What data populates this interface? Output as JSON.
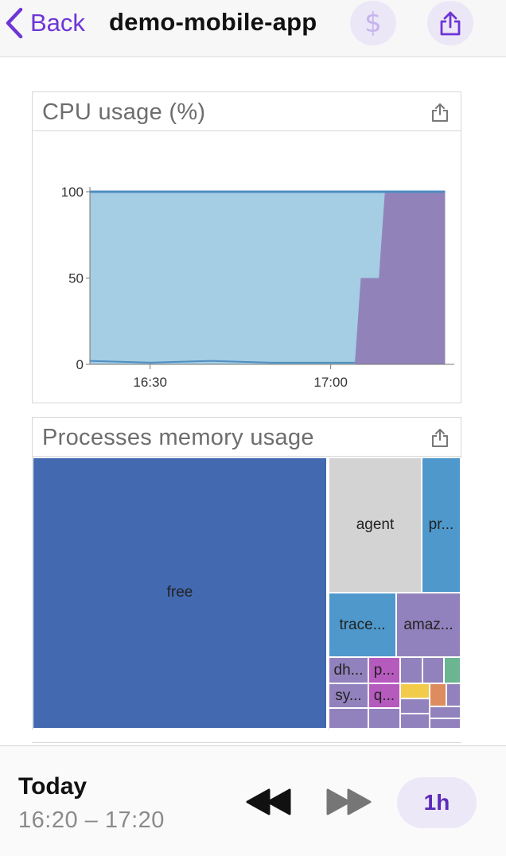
{
  "navbar": {
    "back_label": "Back",
    "title": "demo-mobile-app",
    "dollar_symbol": "$",
    "accent_color": "#6e35d6"
  },
  "cpu_widget": {
    "title": "CPU usage (%)"
  },
  "memory_widget": {
    "title": "Processes memory usage",
    "cells": [
      {
        "label": "free",
        "color": "#4369b0"
      },
      {
        "label": "agent",
        "color": "#d3d3d3"
      },
      {
        "label": "pr...",
        "color": "#4f98cb"
      },
      {
        "label": "trace...",
        "color": "#4f98cb"
      },
      {
        "label": "amaz...",
        "color": "#9182bd"
      },
      {
        "label": "dh...",
        "color": "#9182bd"
      },
      {
        "label": "p...",
        "color": "#b65bbe"
      },
      {
        "label": "sy...",
        "color": "#9182bd"
      },
      {
        "label": "q...",
        "color": "#b65bbe"
      },
      {
        "label": "",
        "color": "#9182bd"
      },
      {
        "label": "",
        "color": "#9182bd"
      },
      {
        "label": "",
        "color": "#6bb593"
      },
      {
        "label": "",
        "color": "#f3cb4a"
      },
      {
        "label": "",
        "color": "#dc8c5e"
      },
      {
        "label": "",
        "color": "#9182bd"
      },
      {
        "label": "",
        "color": "#9182bd"
      },
      {
        "label": "",
        "color": "#9182bd"
      },
      {
        "label": "",
        "color": "#9182bd"
      },
      {
        "label": "",
        "color": "#9182bd"
      },
      {
        "label": "",
        "color": "#9182bd"
      },
      {
        "label": "",
        "color": "#9182bd"
      }
    ]
  },
  "chart_data": {
    "type": "area",
    "title": "CPU usage (%)",
    "xlabel": "",
    "ylabel": "",
    "x_ticks": [
      "16:30",
      "17:00"
    ],
    "x_range": [
      "16:20",
      "17:20"
    ],
    "y_ticks": [
      0,
      50,
      100
    ],
    "ylim": [
      0,
      100
    ],
    "grid": false,
    "series": [
      {
        "color": "#a5cde3",
        "x": [
          "16:20",
          "16:30",
          "16:40",
          "16:50",
          "17:00",
          "17:04",
          "17:05",
          "17:08",
          "17:09",
          "17:19"
        ],
        "values": [
          100,
          100,
          100,
          100,
          100,
          100,
          100,
          100,
          100,
          100
        ]
      },
      {
        "color": "#9183ba",
        "x": [
          "16:20",
          "16:30",
          "16:40",
          "16:50",
          "17:00",
          "17:04",
          "17:05",
          "17:08",
          "17:09",
          "17:19"
        ],
        "values": [
          0,
          0,
          0,
          0,
          0,
          0,
          50,
          50,
          100,
          100
        ]
      }
    ],
    "line_color": "#4e8ec2",
    "bottom_line": {
      "x": [
        "16:20",
        "16:30",
        "16:40",
        "16:50",
        "17:00",
        "17:04"
      ],
      "values": [
        2,
        1,
        2,
        1,
        1,
        1
      ]
    }
  },
  "bottom_bar": {
    "day_label": "Today",
    "time_range": "16:20 – 17:20",
    "zoom_label": "1h"
  }
}
